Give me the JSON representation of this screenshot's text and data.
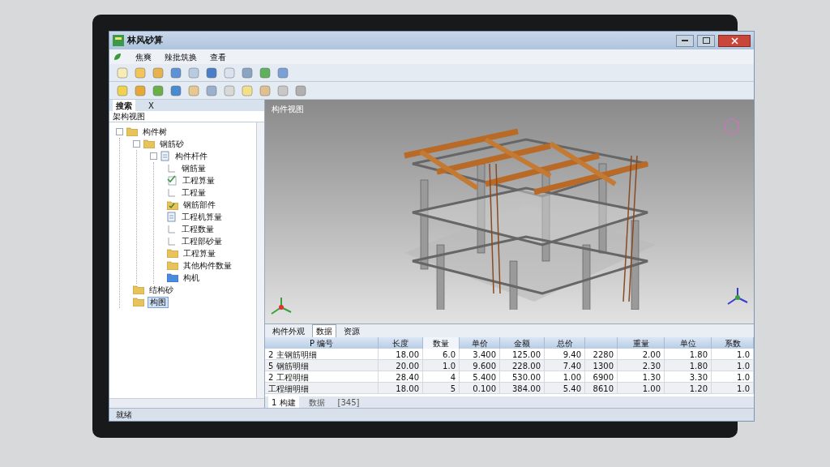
{
  "window": {
    "title": "林风砂算"
  },
  "menu": [
    "焦爽",
    "辣批筑换",
    "查看"
  ],
  "side_panel": {
    "tabs": [
      {
        "label": "搜索",
        "selected": true
      },
      {
        "label": "X",
        "selected": false
      }
    ],
    "header": "架构视图"
  },
  "tree": [
    {
      "label": "构件树",
      "kind": "folder",
      "children": [
        {
          "label": "钢筋砂",
          "kind": "folder",
          "children": [
            {
              "label": "构件杆件",
              "kind": "doc",
              "children": [
                {
                  "label": "钢筋量",
                  "kind": "line",
                  "selected": false
                },
                {
                  "label": "工程算量",
                  "kind": "check",
                  "selected": false
                },
                {
                  "label": "工程量",
                  "kind": "line",
                  "selected": false
                },
                {
                  "label": "钢筋部件",
                  "kind": "folder-check",
                  "selected": false
                },
                {
                  "label": "工程机算量",
                  "kind": "doc",
                  "selected": false
                },
                {
                  "label": "工程数量",
                  "kind": "line",
                  "selected": false
                },
                {
                  "label": "工程部砂量",
                  "kind": "line",
                  "selected": false
                },
                {
                  "label": "工程算量",
                  "kind": "folder",
                  "selected": false
                },
                {
                  "label": "其他构件数量",
                  "kind": "folder",
                  "selected": false
                },
                {
                  "label": "构机",
                  "kind": "blue-folder",
                  "selected": false
                }
              ],
              "selected": false
            }
          ],
          "selected": false
        },
        {
          "label": "结构砂",
          "kind": "folder",
          "selected": false
        },
        {
          "label": "构图",
          "kind": "folder",
          "selected": true
        }
      ],
      "selected": false
    }
  ],
  "viewport": {
    "title": "构件视图"
  },
  "bottom_tabs": [
    {
      "label": "构件外观",
      "selected": false
    },
    {
      "label": "数据",
      "selected": true
    },
    {
      "label": "资源",
      "selected": false
    }
  ],
  "table": {
    "columns": [
      {
        "label": "P 编号",
        "sorted": false
      },
      {
        "label": "长度",
        "sorted": false
      },
      {
        "label": "数量",
        "sorted": true
      },
      {
        "label": "单价",
        "sorted": false
      },
      {
        "label": "金额",
        "sorted": false
      },
      {
        "label": "总价",
        "sorted": false
      },
      {
        "sorted": false
      },
      {
        "label": "重量",
        "sorted": false
      },
      {
        "label": "单位",
        "sorted": false
      },
      {
        "label": "系数",
        "sorted": false
      }
    ],
    "rows": [
      [
        "2 主钢筋明细",
        "18.00",
        "6.0",
        "3.400",
        "125.00",
        "9.40",
        "2280",
        "2.00",
        "1.80",
        "1.0"
      ],
      [
        "5 钢筋明细",
        "20.00",
        "1.0",
        "9.600",
        "228.00",
        "7.40",
        "1300",
        "2.30",
        "1.80",
        "1.0"
      ],
      [
        "2 工程明细",
        "28.40",
        "4",
        "5.400",
        "530.00",
        "1.00",
        "6900",
        "1.30",
        "3.30",
        "1.0"
      ],
      [
        "工程细明细",
        "18.00",
        "5",
        "0.100",
        "384.00",
        "5.40",
        "8610",
        "1.00",
        "1.20",
        "1.0"
      ]
    ]
  },
  "sheet_tabs": [
    {
      "label": "1 构建",
      "selected": true
    },
    {
      "label": "数据",
      "selected": false
    },
    {
      "label": "[345]",
      "selected": false
    }
  ],
  "status_bar": {
    "text": "就绪"
  }
}
